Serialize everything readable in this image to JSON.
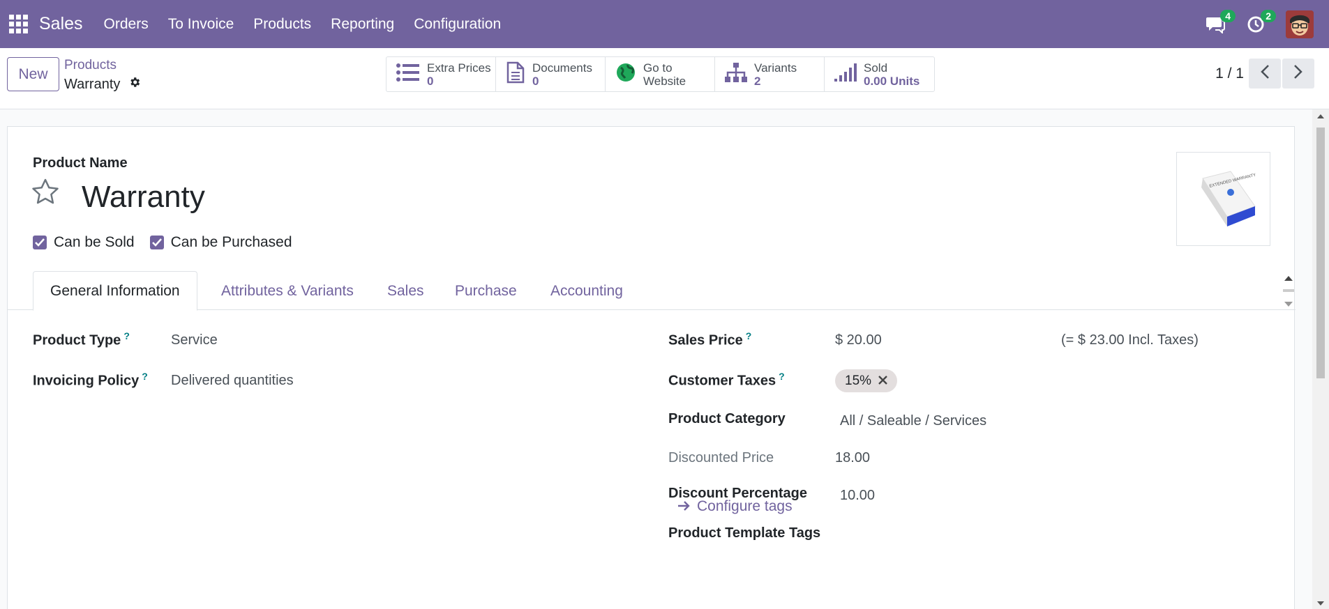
{
  "nav": {
    "app_title": "Sales",
    "items": [
      "Orders",
      "To Invoice",
      "Products",
      "Reporting",
      "Configuration"
    ],
    "messages_count": "4",
    "activities_count": "2"
  },
  "control": {
    "new_label": "New",
    "breadcrumb_parent": "Products",
    "breadcrumb_current": "Warranty",
    "smart_buttons": [
      {
        "label": "Extra Prices",
        "value": "0",
        "icon": "list-icon"
      },
      {
        "label": "Documents",
        "value": "0",
        "icon": "document-icon"
      },
      {
        "label": "Go to",
        "value": "Website",
        "icon": "globe-icon"
      },
      {
        "label": "Variants",
        "value": "2",
        "icon": "sitemap-icon"
      },
      {
        "label": "Sold",
        "value": "0.00 Units",
        "icon": "signal-icon"
      }
    ],
    "pager": "1 / 1"
  },
  "form": {
    "name_label": "Product Name",
    "product_name": "Warranty",
    "can_be_sold": "Can be Sold",
    "can_be_purchased": "Can be Purchased",
    "image_text": "EXTENDED WARRANTY",
    "tabs": [
      "General Information",
      "Attributes & Variants",
      "Sales",
      "Purchase",
      "Accounting"
    ],
    "left": {
      "product_type_label": "Product Type",
      "product_type": "Service",
      "invoicing_policy_label": "Invoicing Policy",
      "invoicing_policy": "Delivered quantities"
    },
    "right": {
      "sales_price_label": "Sales Price",
      "sales_price": "$ 20.00",
      "incl_taxes": "(= $ 23.00 Incl. Taxes)",
      "customer_taxes_label": "Customer Taxes",
      "tax_tag": "15%",
      "product_category_label": "Product Category",
      "product_category": "All / Saleable / Services",
      "discounted_price_label": "Discounted Price",
      "discounted_price": "18.00",
      "discount_percentage_label": "Discount Percentage",
      "discount_percentage": "10.00",
      "template_tags_label": "Product Template Tags",
      "configure_tags": "Configure tags"
    },
    "help_mark": "?"
  }
}
